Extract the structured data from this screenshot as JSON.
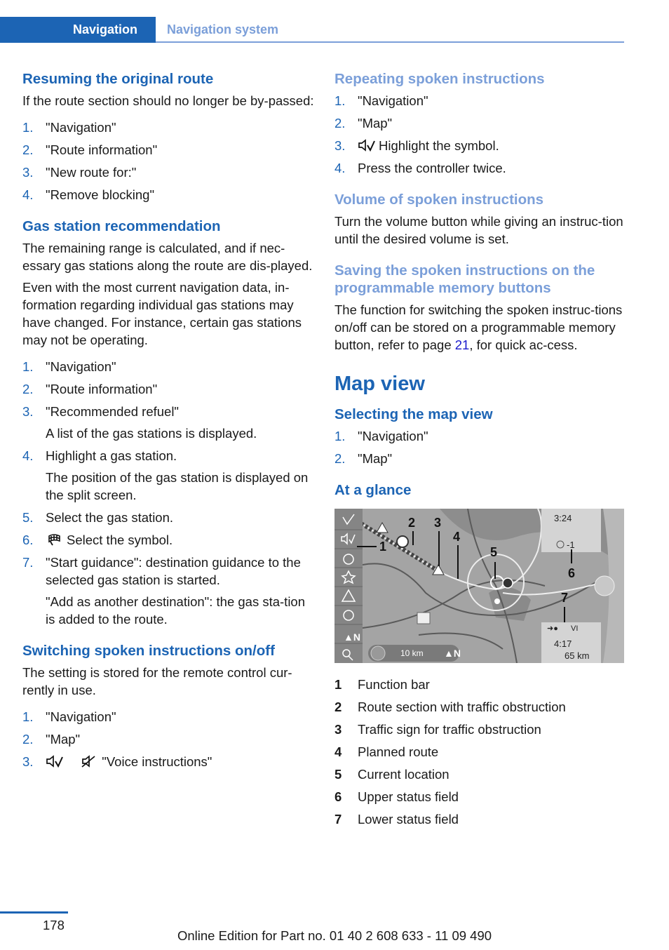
{
  "header": {
    "section_tab": "Navigation",
    "breadcrumb": "Navigation system"
  },
  "left": {
    "resume": {
      "title": "Resuming the original route",
      "intro": "If the route section should no longer be by-passed:",
      "steps": [
        "\"Navigation\"",
        "\"Route information\"",
        "\"New route for:\"",
        "\"Remove blocking\""
      ]
    },
    "gas": {
      "title": "Gas station recommendation",
      "para1": "The remaining range is calculated, and if nec-essary gas stations along the route are dis-played.",
      "para2": "Even with the most current navigation data, in-formation regarding individual gas stations may have changed. For instance, certain gas stations may not be operating.",
      "steps": [
        {
          "num": "1.",
          "text": "\"Navigation\""
        },
        {
          "num": "2.",
          "text": "\"Route information\""
        },
        {
          "num": "3.",
          "text": "\"Recommended refuel\"",
          "sub": "A list of the gas stations is displayed."
        },
        {
          "num": "4.",
          "text": "Highlight a gas station.",
          "sub": "The position of the gas station is displayed on the split screen."
        },
        {
          "num": "5.",
          "text": "Select the gas station."
        },
        {
          "num": "6.",
          "text": "Select the symbol.",
          "icon": "destination-flag-icon"
        },
        {
          "num": "7.",
          "text": "\"Start guidance\": destination guidance to the selected gas station is started.",
          "sub": "\"Add as another destination\": the gas sta-tion is added to the route."
        }
      ]
    },
    "switching": {
      "title": "Switching spoken instructions on/off",
      "intro": "The setting is stored for the remote control cur-rently in use.",
      "steps": [
        "\"Navigation\"",
        "\"Map\"",
        "\"Voice instructions\""
      ],
      "step3_icons": [
        "voice-on-icon",
        "voice-off-icon"
      ]
    }
  },
  "right": {
    "repeat": {
      "title": "Repeating spoken instructions",
      "steps": [
        "\"Navigation\"",
        "\"Map\"",
        "Highlight the symbol.",
        "Press the controller twice."
      ],
      "step3_icon": "voice-on-icon"
    },
    "volume": {
      "title": "Volume of spoken instructions",
      "text": "Turn the volume button while giving an instruc-tion until the desired volume is set."
    },
    "saving": {
      "title": "Saving the spoken instructions on the programmable memory buttons",
      "text_before": "The function for switching the spoken instruc-tions on/off can be stored on a programmable memory button, refer to page ",
      "link": "21",
      "text_after": ", for quick ac-cess."
    },
    "mapview": {
      "title": "Map view",
      "selecting_title": "Selecting the map view",
      "steps": [
        "\"Navigation\"",
        "\"Map\""
      ],
      "glance_title": "At a glance"
    },
    "map": {
      "upper_time": "3:24",
      "upper_value": "-1",
      "lower_direction": "VI",
      "lower_time": "4:17",
      "lower_distance": "65 km",
      "scale": "10 km",
      "north": "N",
      "callouts": [
        "1",
        "2",
        "3",
        "4",
        "5",
        "6",
        "7"
      ]
    },
    "legend": [
      {
        "num": "1",
        "text": "Function bar"
      },
      {
        "num": "2",
        "text": "Route section with traffic obstruction"
      },
      {
        "num": "3",
        "text": "Traffic sign for traffic obstruction"
      },
      {
        "num": "4",
        "text": "Planned route"
      },
      {
        "num": "5",
        "text": "Current location"
      },
      {
        "num": "6",
        "text": "Upper status field"
      },
      {
        "num": "7",
        "text": "Lower status field"
      }
    ]
  },
  "footer": {
    "page": "178",
    "edition": "Online Edition for Part no. 01 40 2 608 633 - 11 09 490"
  },
  "colors": {
    "brand_blue": "#1c64b4",
    "light_blue": "#7b9fd9",
    "link_blue": "#1a1acc"
  }
}
